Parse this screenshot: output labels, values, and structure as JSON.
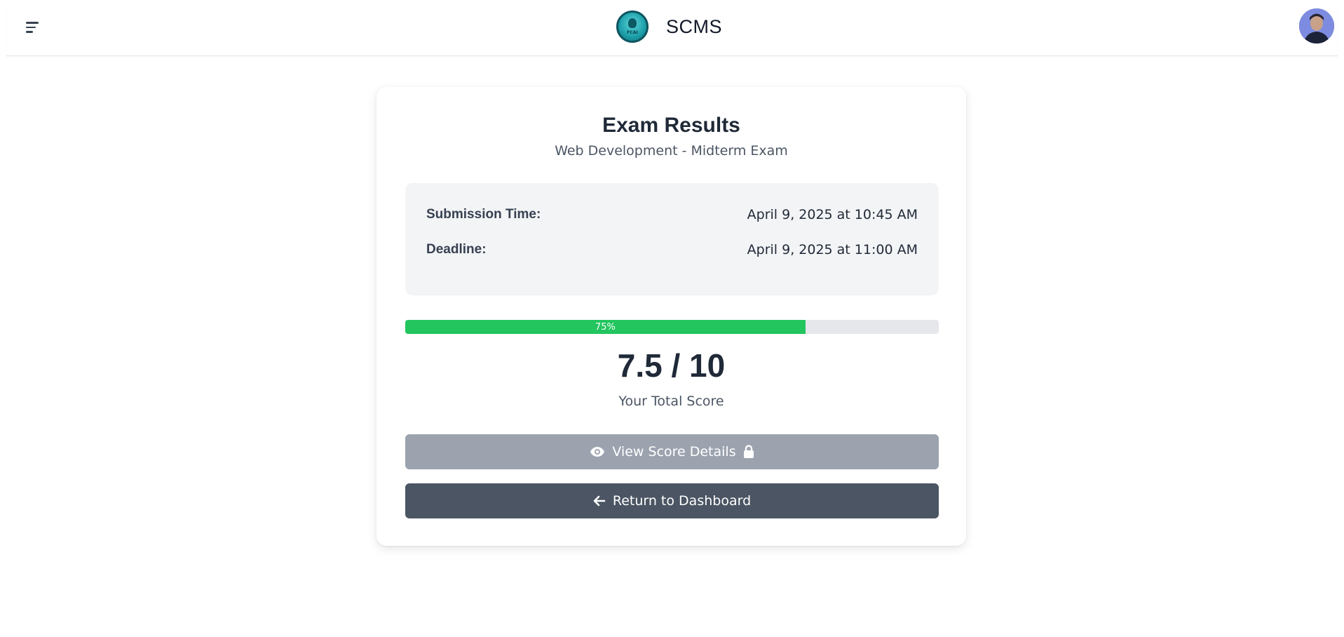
{
  "header": {
    "brand_name": "SCMS",
    "logo_text": "FCAI"
  },
  "exam": {
    "title": "Exam Results",
    "subtitle": "Web Development - Midterm Exam"
  },
  "info": {
    "submission_label": "Submission Time:",
    "submission_value": "April 9, 2025 at 10:45 AM",
    "deadline_label": "Deadline:",
    "deadline_value": "April 9, 2025 at 11:00 AM"
  },
  "progress": {
    "percent": 75,
    "label": "75%",
    "color": "#22c55e"
  },
  "score": {
    "value": "7.5 / 10",
    "label": "Your Total Score"
  },
  "buttons": {
    "view_details": {
      "label": "View Score Details",
      "icon_left": "eye-icon",
      "icon_right": "lock-icon",
      "color": "#9ca3af"
    },
    "return": {
      "label": "Return to Dashboard",
      "icon_left": "arrow-left-icon",
      "color": "#4b5563"
    }
  }
}
